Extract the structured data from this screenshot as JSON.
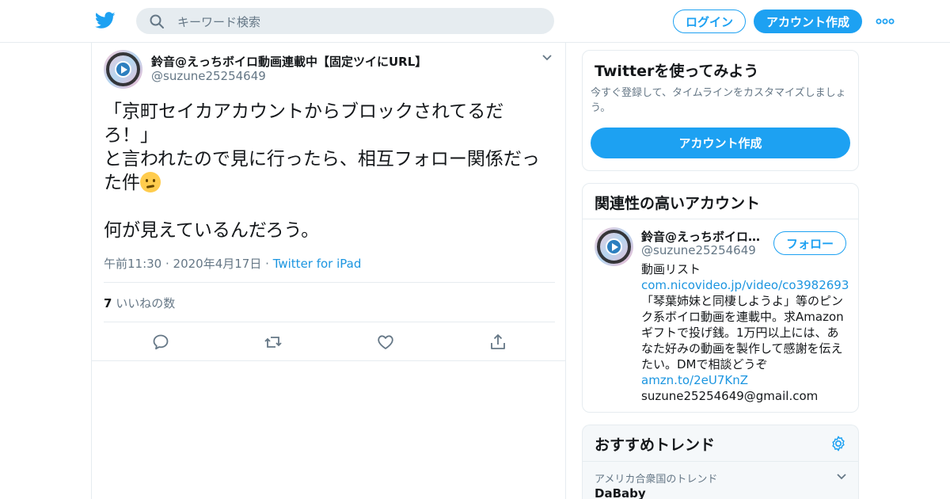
{
  "header": {
    "search_placeholder": "キーワード検索",
    "login_label": "ログイン",
    "signup_label": "アカウント作成",
    "accent_color": "#1da1f2"
  },
  "tweet": {
    "author_name": "鈴音@えっちボイロ動画連載中【固定ツイにURL】",
    "author_handle": "@suzune25254649",
    "text_part1": "「京町セイカアカウントからブロックされてるだろ！」\nと言われたので見に行ったら、相互フォロー関係だった件",
    "emoji": "thinking-face",
    "text_part2": "\n\n何が見えているんだろう。",
    "timestamp": "午前11:30 · 2020年4月17日",
    "separator": "·",
    "source": "Twitter for iPad",
    "likes_count": "7",
    "likes_label": "いいねの数"
  },
  "sidebar": {
    "signup_card": {
      "title": "Twitterを使ってみよう",
      "description": "今すぐ登録して、タイムラインをカスタマイズしましょう。",
      "button_label": "アカウント作成"
    },
    "related_card": {
      "title": "関連性の高いアカウント",
      "name": "鈴音@えっちボイロ動画連載中【固定ツイにURL】",
      "handle": "@suzune25254649",
      "follow_label": "フォロー",
      "bio_line1": "動画リスト",
      "bio_link1": "com.nicovideo.jp/video/co3982693",
      "bio_text": "「琴葉姉妹と同棲しようよ」等のピンク系ボイロ動画を連載中。求Amazonギフトで投げ銭。1万円以上には、あなた好みの動画を製作して感謝を伝えたい。DMで相談どうぞ",
      "bio_link2": "amzn.to/2eU7KnZ",
      "bio_email": "suzune25254649@gmail.com"
    },
    "trend_card": {
      "title": "おすすめトレンド",
      "location": "アメリカ合衆国のトレンド",
      "trend_name": "DaBaby"
    }
  }
}
